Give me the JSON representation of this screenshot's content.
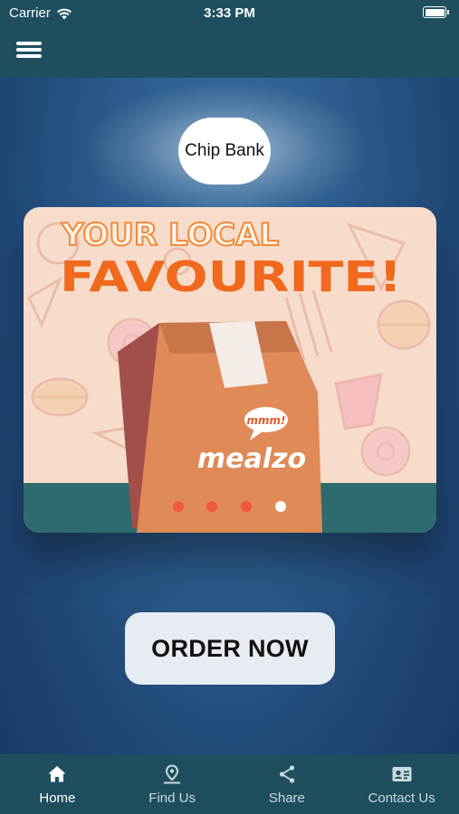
{
  "status_bar": {
    "carrier": "Carrier",
    "time": "3:33 PM"
  },
  "header": {
    "menu_icon": "hamburger-menu-icon"
  },
  "brand": {
    "name": "Chip Bank"
  },
  "banner": {
    "headline_line1": "YOUR LOCAL",
    "headline_line2": "FAVOURITE!",
    "bag_brand": "mealzo",
    "bag_tag": "mmm!",
    "carousel": {
      "total": 4,
      "active_index": 3
    },
    "colors": {
      "background": "#f7dccb",
      "headline": "#f0691d",
      "bag": "#df8a57",
      "ground": "#2d6b6e",
      "dot_inactive": "#f05a3a",
      "dot_active": "#ffffff"
    }
  },
  "order_button": {
    "label": "ORDER NOW"
  },
  "tab_bar": {
    "tabs": [
      {
        "label": "Home",
        "icon": "home-icon",
        "active": true
      },
      {
        "label": "Find Us",
        "icon": "map-pin-icon",
        "active": false
      },
      {
        "label": "Share",
        "icon": "share-icon",
        "active": false
      },
      {
        "label": "Contact Us",
        "icon": "contact-card-icon",
        "active": false
      }
    ]
  },
  "colors": {
    "top_bar": "#1f4f5f",
    "tab_bar": "#1f4f5f",
    "background": "#2c5d8e"
  }
}
